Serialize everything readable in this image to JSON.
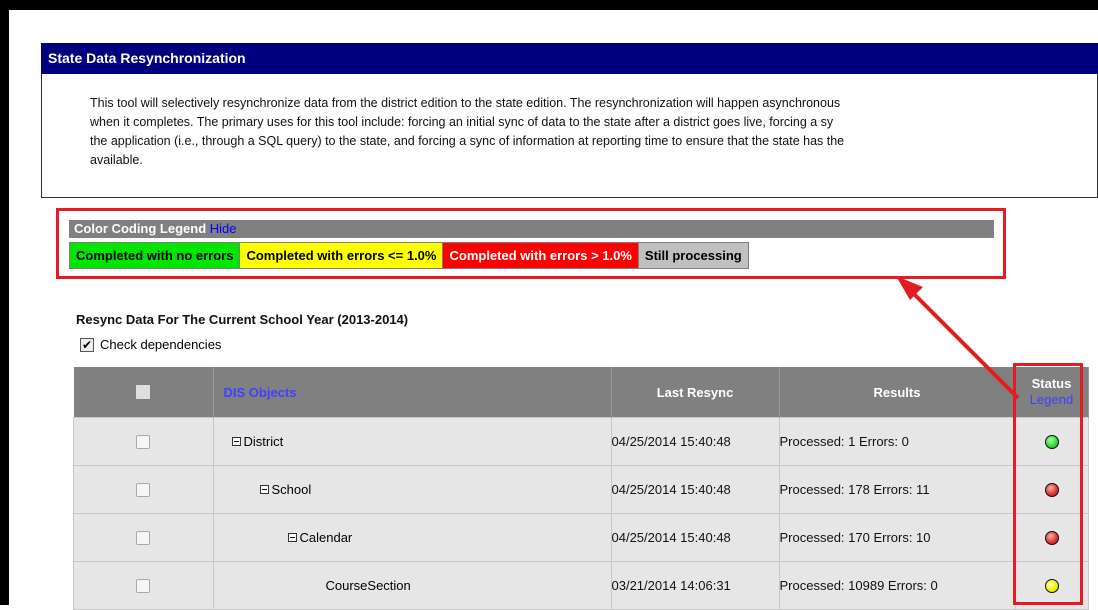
{
  "header": {
    "title": "State Data Resynchronization"
  },
  "description": {
    "lines": [
      "This tool will selectively resynchronize data from the district edition to the state edition. The resynchronization will happen asynchronous",
      "when it completes. The primary uses for this tool include: forcing an initial sync of data to the state after a district goes live, forcing a sy",
      "the application (i.e., through a SQL query) to the state, and forcing a sync of information at reporting time to ensure that the state has the",
      "available."
    ]
  },
  "legend": {
    "title": "Color Coding Legend",
    "hide_label": "Hide",
    "items": [
      {
        "label": "Completed with no errors",
        "color": "#00e600",
        "text_color": "#000000"
      },
      {
        "label": "Completed with errors <= 1.0%",
        "color": "#ffff00",
        "text_color": "#000000"
      },
      {
        "label": "Completed with errors > 1.0%",
        "color": "#ff0000",
        "text_color": "#ffffff"
      },
      {
        "label": "Still processing",
        "color": "#c0c0c0",
        "text_color": "#000000"
      }
    ]
  },
  "section": {
    "title": "Resync Data For The Current School Year (2013-2014)",
    "check_dependencies_label": "Check dependencies",
    "check_dependencies_checked": true
  },
  "table": {
    "headers": {
      "objects": "DIS Objects",
      "last_resync": "Last Resync",
      "results": "Results",
      "status": "Status",
      "status_legend": "Legend"
    },
    "rows": [
      {
        "name": "District",
        "indent": 0,
        "toggle": true,
        "last_resync": "04/25/2014 15:40:48",
        "results": "Processed: 1 Errors: 0",
        "status": "green"
      },
      {
        "name": "School",
        "indent": 1,
        "toggle": true,
        "last_resync": "04/25/2014 15:40:48",
        "results": "Processed: 178 Errors: 11",
        "status": "red"
      },
      {
        "name": "Calendar",
        "indent": 2,
        "toggle": true,
        "last_resync": "04/25/2014 15:40:48",
        "results": "Processed: 170 Errors: 10",
        "status": "red"
      },
      {
        "name": "CourseSection",
        "indent": 3,
        "toggle": false,
        "last_resync": "03/21/2014 14:06:31",
        "results": "Processed: 10989 Errors: 0",
        "status": "yellow"
      }
    ]
  },
  "colors": {
    "header_bg": "#00007f",
    "status_green": "#2fd42f",
    "status_red": "#e0302c",
    "status_yellow": "#f0f000",
    "highlight_red": "#e31b23"
  }
}
